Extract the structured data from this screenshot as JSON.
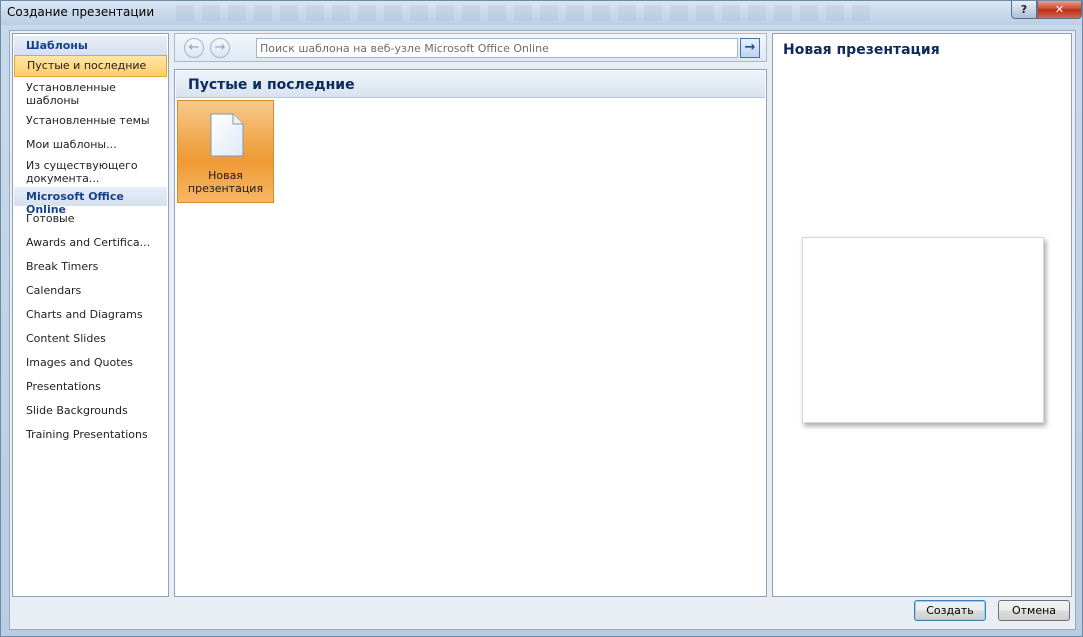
{
  "window": {
    "title": "Создание презентации",
    "help_glyph": "?",
    "close_glyph": "✕"
  },
  "sidebar": {
    "header_templates": "Шаблоны",
    "items_local": [
      {
        "label": "Пустые и последние",
        "selected": true
      },
      {
        "label": "Установленные шаблоны",
        "selected": false
      },
      {
        "label": "Установленные темы",
        "selected": false
      },
      {
        "label": "Мои шаблоны...",
        "selected": false
      },
      {
        "label": "Из существующего документа...",
        "selected": false
      }
    ],
    "header_online": "Microsoft Office Online",
    "items_online": [
      "Готовые",
      "Awards and Certifica...",
      "Break Timers",
      "Calendars",
      "Charts and Diagrams",
      "Content Slides",
      "Images and Quotes",
      "Presentations",
      "Slide Backgrounds",
      "Training Presentations"
    ]
  },
  "navbar": {
    "back_glyph": "←",
    "forward_glyph": "→",
    "search_placeholder": "Поиск шаблона на веб-узле Microsoft Office Online",
    "go_glyph": "→"
  },
  "main": {
    "section_title": "Пустые и последние",
    "tiles": [
      {
        "label_line1": "Новая",
        "label_line2": "презентация",
        "icon": "blank-document-icon",
        "selected": true
      }
    ]
  },
  "preview": {
    "title": "Новая презентация"
  },
  "buttons": {
    "create": "Создать",
    "cancel": "Отмена"
  },
  "colors": {
    "selection_orange": "#f0a445",
    "header_navy": "#0c2a5e",
    "frame_blue": "#c8d9ea"
  }
}
